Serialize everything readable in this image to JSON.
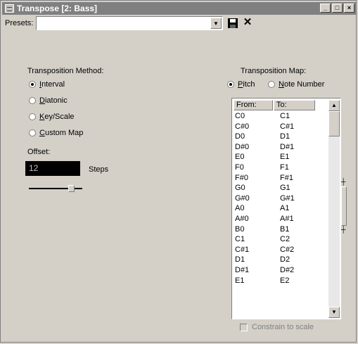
{
  "window": {
    "title": "Transpose [2: Bass]",
    "buttons": {
      "minimize": "_",
      "maximize": "□",
      "close": "×"
    }
  },
  "presets": {
    "label": "Presets:",
    "value": "",
    "save_icon": "save-icon",
    "delete_icon": "delete-icon"
  },
  "method": {
    "label": "Transposition Method:",
    "options": [
      {
        "label": "Interval",
        "checked": true
      },
      {
        "label": "Diatonic",
        "checked": false
      },
      {
        "label": "Key/Scale",
        "checked": false
      },
      {
        "label": "Custom Map",
        "checked": false
      }
    ],
    "offset_label": "Offset:",
    "offset_value": "12",
    "steps_label": "Steps"
  },
  "map": {
    "label": "Transposition Map:",
    "options": [
      {
        "label": "Pitch",
        "checked": true
      },
      {
        "label": "Note Number",
        "checked": false
      }
    ],
    "headers": {
      "from": "From:",
      "to": "To:"
    },
    "rows": [
      [
        "C0",
        "C1"
      ],
      [
        "C#0",
        "C#1"
      ],
      [
        "D0",
        "D1"
      ],
      [
        "D#0",
        "D#1"
      ],
      [
        "E0",
        "E1"
      ],
      [
        "F0",
        "F1"
      ],
      [
        "F#0",
        "F#1"
      ],
      [
        "G0",
        "G1"
      ],
      [
        "G#0",
        "G#1"
      ],
      [
        "A0",
        "A1"
      ],
      [
        "A#0",
        "A#1"
      ],
      [
        "B0",
        "B1"
      ],
      [
        "C1",
        "C2"
      ],
      [
        "C#1",
        "C#2"
      ],
      [
        "D1",
        "D2"
      ],
      [
        "D#1",
        "D#2"
      ],
      [
        "E1",
        "E2"
      ]
    ],
    "constrain_label": "Constrain to scale",
    "constrain_checked": false
  }
}
